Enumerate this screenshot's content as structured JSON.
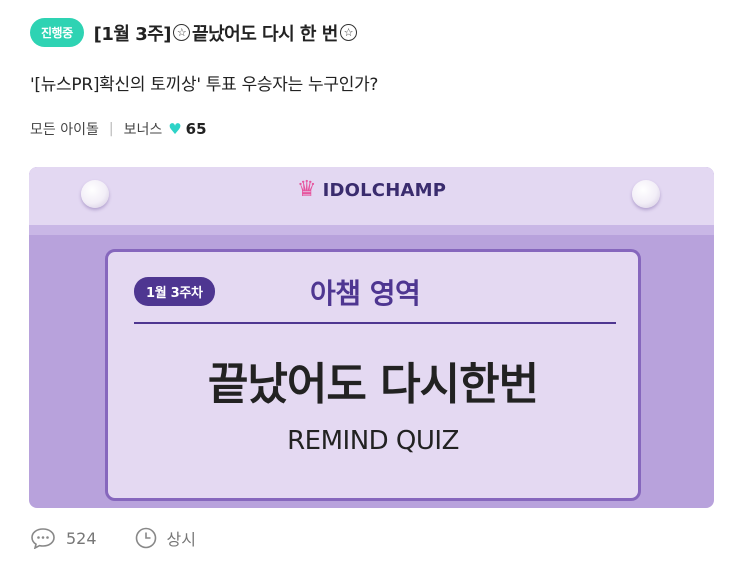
{
  "header": {
    "status_badge": "진행중",
    "title_prefix": "[1월 3주]",
    "title_main": "끝났어도 다시 한 번",
    "title_icon": "star-circle-icon"
  },
  "question": "'[뉴스PR]확신의 토끼상' 투표 우승자는 누구인가?",
  "meta": {
    "audience": "모든 아이돌",
    "bonus_label": "보너스",
    "bonus_icon": "heart-icon",
    "bonus_value": "65"
  },
  "banner": {
    "brand": "IDOLCHAMP",
    "week_pill": "1월 3주차",
    "area_title": "아챔 영역",
    "big_title": "끝났어도 다시한번",
    "subtitle": "REMIND QUIZ",
    "colors": {
      "background": "#b8a2dc",
      "card": "#e4d9f2",
      "accent": "#4e3691",
      "crown": "#e6559e"
    }
  },
  "footer": {
    "comment_icon": "comment-icon",
    "comment_count": "524",
    "clock_icon": "clock-icon",
    "duration": "상시"
  },
  "colors": {
    "badge": "#2ed3b3",
    "heart": "#2ed3c7"
  }
}
